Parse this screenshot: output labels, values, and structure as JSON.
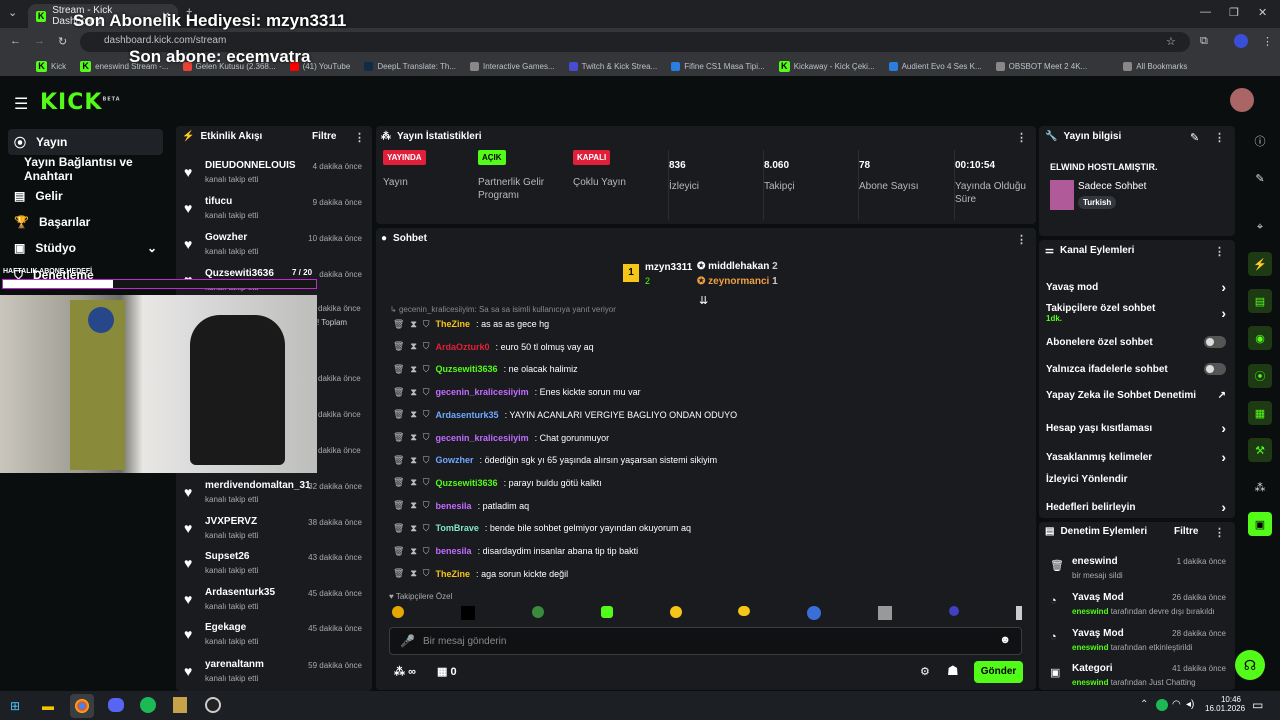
{
  "browser": {
    "tab_title": "Stream - Kick Dashboard",
    "url": "dashboard.kick.com/stream",
    "bookmarks": [
      "Kick",
      "eneswind Stream -...",
      "Gelen Kutusu (2.368...",
      "(41) YouTube",
      "DeepL Translate: Th...",
      "Interactive Games...",
      "Twitch & Kick Strea...",
      "Fifine CS1 Masa Tipi...",
      "Kickaway - Kick Çeki...",
      "Audient Evo 4 Ses K...",
      "OBSBOT Meet 2 4K..."
    ],
    "all_bookmarks": "All Bookmarks"
  },
  "overlay": {
    "sub_gift": "Son Abonelik Hediyesi: mzyn3311",
    "last_sub": "Son abone: ecemvatra",
    "weekly_goal": "HAFTALIK ABONE HEDEFİ",
    "goal_count": "7 / 20"
  },
  "logo": "KICK",
  "logo_beta": "BETA",
  "sidebar": {
    "items": [
      "Yayın",
      "Yayın Bağlantısı ve Anahtarı",
      "Gelir",
      "Başarılar",
      "Stüdyo",
      "Denetleme"
    ]
  },
  "activity": {
    "title": "Etkinlik Akışı",
    "filter": "Filtre",
    "events": [
      {
        "name": "DIEUDONNELOUIS",
        "sub": "kanalı takip etti",
        "time": "4 dakika önce"
      },
      {
        "name": "tifucu",
        "sub": "kanalı takip etti",
        "time": "9 dakika önce"
      },
      {
        "name": "Gowzher",
        "sub": "kanalı takip etti",
        "time": "10 dakika önce"
      },
      {
        "name": "Quzsewiti3636",
        "sub": "kanalı takip etti",
        "time": "dakika önce"
      },
      {
        "name": "merdivendomaltan_31",
        "sub": "kanalı takip etti",
        "time": "32 dakika önce"
      },
      {
        "name": "JVXPERVZ",
        "sub": "kanalı takip etti",
        "time": "38 dakika önce"
      },
      {
        "name": "Supset26",
        "sub": "kanalı takip etti",
        "time": "43 dakika önce"
      },
      {
        "name": "Ardasenturk35",
        "sub": "kanalı takip etti",
        "time": "45 dakika önce"
      },
      {
        "name": "Egekage",
        "sub": "kanalı takip etti",
        "time": "45 dakika önce"
      },
      {
        "name": "yarenaltanm",
        "sub": "kanalı takip etti",
        "time": "59 dakika önce"
      }
    ],
    "partial_times": [
      "dakika önce",
      "dakika önce",
      "dakika önce",
      "dakika önce"
    ],
    "partial_text": "! Toplam"
  },
  "stats": {
    "title": "Yayın İstatistikleri",
    "items": [
      {
        "badge": "YAYINDA",
        "label": "Yayın",
        "color": "#e0203a"
      },
      {
        "badge": "AÇIK",
        "label": "Partnerlik Gelir Programı",
        "color": "#53fc18"
      },
      {
        "badge": "KAPALI",
        "label": "Çoklu Yayın",
        "color": "#e0203a"
      },
      {
        "value": "836",
        "label": "İzleyici"
      },
      {
        "value": "8.060",
        "label": "Takipçi"
      },
      {
        "value": "78",
        "label": "Abone Sayısı"
      },
      {
        "value": "00:10:54",
        "label": "Yayında Olduğu Süre"
      }
    ]
  },
  "chat": {
    "title": "Sohbet",
    "gifters": [
      {
        "name": "mzyn3311",
        "count": "2",
        "rank": "1"
      },
      {
        "name": "middlehakan",
        "count": "2"
      },
      {
        "name": "zeynormanci",
        "count": "1"
      }
    ],
    "reply_hint": "gecenin_kralicesiiyim: Sa sa sa isimli kullanıcıya yanıt veriyor",
    "messages": [
      {
        "user": "TheZine",
        "text": "as as as gece hg",
        "color": "#f5c518"
      },
      {
        "user": "ArdaOzturk0",
        "text": "euro 50 tl olmuş vay aq",
        "color": "#e0203a"
      },
      {
        "user": "Quzsewiti3636",
        "text": "ne olacak halimiz",
        "color": "#53fc18"
      },
      {
        "user": "gecenin_kralicesiiyim",
        "text": "Enes kickte sorun mu var",
        "color": "#c26bff"
      },
      {
        "user": "Ardasenturk35",
        "text": "YAYIN ACANLARI VERGIYE BAGLIYO ONDAN ODUYO",
        "color": "#6fa8ff"
      },
      {
        "user": "gecenin_kralicesiiyim",
        "text": "Chat gorunmuyor",
        "color": "#c26bff"
      },
      {
        "user": "Gowzher",
        "text": "ödediğin sgk yı 65 yaşında alırsın yaşarsan sistemi sikiyim",
        "color": "#6fa8ff"
      },
      {
        "user": "Quzsewiti3636",
        "text": "parayı buldu götü kalktı",
        "color": "#53fc18"
      },
      {
        "user": "benesila",
        "text": "patladim aq",
        "color": "#c26bff"
      },
      {
        "user": "TomBrave",
        "text": "bende bile sohbet gelmiyor yayından okuyorum aq",
        "color": "#7ee8c8"
      },
      {
        "user": "benesila",
        "text": "disardaydim insanlar abana tip tip bakti",
        "color": "#c26bff"
      },
      {
        "user": "TheZine",
        "text": "aga sorun kickte değil",
        "color": "#f5c518"
      }
    ],
    "followers_only": "Takipçilere Özel",
    "placeholder": "Bir mesaj gönderin",
    "send": "Gönder",
    "infinity": "∞",
    "count": "0"
  },
  "info": {
    "title": "Yayın bilgisi",
    "stream_title": "ELWIND HOSTLAMIŞTIR.",
    "category": "Sadece Sohbet",
    "language": "Turkish"
  },
  "channel": {
    "title": "Kanal Eylemleri",
    "actions": [
      {
        "label": "Yavaş mod",
        "type": "arrow"
      },
      {
        "label": "Takipçilere özel sohbet",
        "sub": "1dk.",
        "type": "arrow"
      },
      {
        "label": "Abonelere özel sohbet",
        "type": "toggle"
      },
      {
        "label": "Yalnızca ifadelerle sohbet",
        "type": "toggle"
      },
      {
        "label": "Yapay Zeka ile Sohbet Denetimi",
        "type": "ext"
      },
      {
        "label": "Hesap yaşı kısıtlaması",
        "type": "arrow"
      },
      {
        "label": "Yasaklanmış kelimeler",
        "type": "arrow"
      },
      {
        "label": "İzleyici Yönlendir",
        "type": "none"
      },
      {
        "label": "Hedefleri belirleyin",
        "type": "arrow"
      }
    ]
  },
  "mod": {
    "title": "Denetim Eylemleri",
    "filter": "Filtre",
    "items": [
      {
        "title": "eneswind",
        "sub": "bir mesajı sildi",
        "time": "1 dakika önce"
      },
      {
        "title": "Yavaş Mod",
        "user": "eneswind",
        "sub": "tarafından devre dışı bırakıldı",
        "time": "26 dakika önce"
      },
      {
        "title": "Yavaş Mod",
        "user": "eneswind",
        "sub": "tarafından etkinleştirildi",
        "time": "28 dakika önce"
      },
      {
        "title": "Kategori",
        "user": "eneswind",
        "sub": "tarafından Just Chatting",
        "time": "41 dakika önce"
      }
    ]
  },
  "taskbar": {
    "time": "10:46",
    "date": "16.01.2026"
  }
}
